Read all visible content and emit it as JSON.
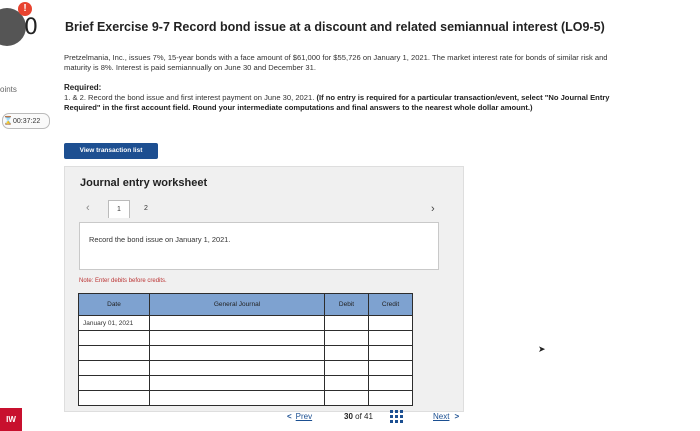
{
  "left_rail": {
    "score_value": "0",
    "points_label": "oints",
    "timer": "00:37:22",
    "badge_label": "IW"
  },
  "header": {
    "title": "Brief Exercise 9-7 Record bond issue at a discount and related semiannual interest (LO9-5)",
    "intro": "Pretzelmania, Inc., issues 7%, 15-year bonds with a face amount of $61,000 for $55,726 on January 1, 2021. The market interest rate for bonds of similar risk and maturity is 8%. Interest is paid semiannually on June 30 and December 31.",
    "required_heading": "Required:",
    "required_plain": "1. & 2. Record the bond issue and first interest payment on June 30, 2021.",
    "required_bold": "(If no entry is required for a particular transaction/event, select \"No Journal Entry Required\" in the first account field. Round your intermediate computations and final answers to the nearest whole dollar amount.)"
  },
  "view_button": "View transaction list",
  "worksheet": {
    "title": "Journal entry worksheet",
    "tabs": [
      "1",
      "2"
    ],
    "active_tab": "1",
    "instruction": "Record the bond issue on January 1, 2021.",
    "note": "Note: Enter debits before credits.",
    "columns": {
      "date": "Date",
      "account": "General Journal",
      "debit": "Debit",
      "credit": "Credit"
    },
    "rows": [
      {
        "date": "January 01, 2021",
        "account": "",
        "debit": "",
        "credit": ""
      },
      {
        "date": "",
        "account": "",
        "debit": "",
        "credit": ""
      },
      {
        "date": "",
        "account": "",
        "debit": "",
        "credit": ""
      },
      {
        "date": "",
        "account": "",
        "debit": "",
        "credit": ""
      },
      {
        "date": "",
        "account": "",
        "debit": "",
        "credit": ""
      },
      {
        "date": "",
        "account": "",
        "debit": "",
        "credit": ""
      }
    ]
  },
  "footer": {
    "prev_label": "Prev",
    "current": "30",
    "of_word": "of",
    "total": "41",
    "next_label": "Next"
  },
  "colors": {
    "header_fill": "#7ea2d0",
    "button_blue": "#1d4f91",
    "link_blue": "#1b4f91",
    "badge_red": "#c8102e",
    "warn_red": "#e8432f"
  }
}
